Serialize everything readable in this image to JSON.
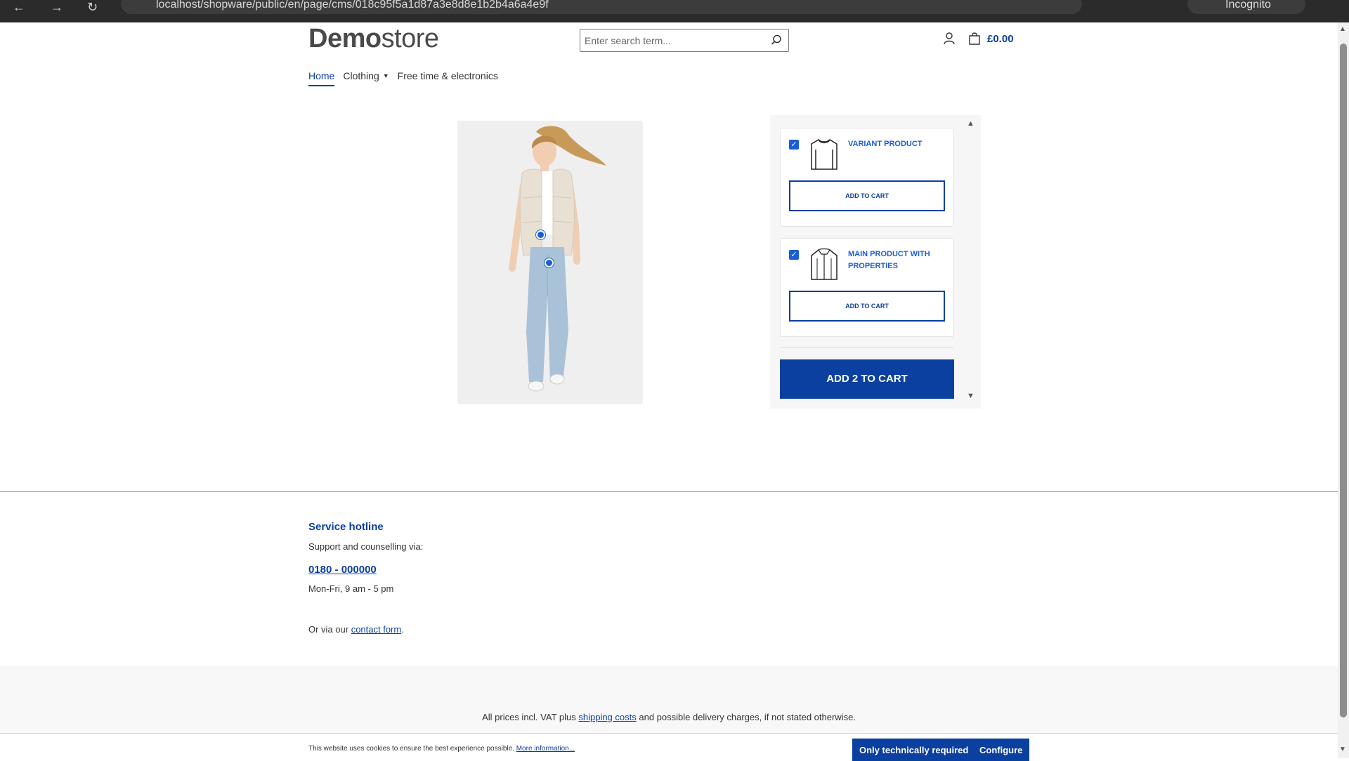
{
  "browser": {
    "url": "localhost/shopware/public/en/page/cms/018c95f5a1d87a3e8d8e1b2b4a6a4e9f",
    "mode_label": "Incognito"
  },
  "header": {
    "logo_bold": "Demo",
    "logo_light": "store",
    "search_placeholder": "Enter search term...",
    "cart_total": "£0.00"
  },
  "nav": {
    "items": [
      {
        "label": "Home",
        "active": true
      },
      {
        "label": "Clothing",
        "dropdown": true
      },
      {
        "label": "Free time & electronics"
      }
    ]
  },
  "cross_selling": {
    "products": [
      {
        "name": "VARIANT PRODUCT",
        "checked": true,
        "icon": "sweater-icon",
        "button": "ADD TO CART"
      },
      {
        "name": "MAIN PRODUCT WITH PROPERTIES",
        "checked": true,
        "icon": "jacket-icon",
        "button": "ADD TO CART"
      }
    ],
    "add_all_label": "ADD 2 TO CART"
  },
  "footer": {
    "hotline_title": "Service hotline",
    "hotline_desc": "Support and counselling via:",
    "phone": "0180 - 000000",
    "hours": "Mon-Fri, 9 am - 5 pm",
    "contact_prefix": "Or via our ",
    "contact_link": "contact form",
    "contact_suffix": ".",
    "vat_prefix": "All prices incl. VAT plus ",
    "vat_link": "shipping costs",
    "vat_suffix": " and possible delivery charges, if not stated otherwise."
  },
  "cookie": {
    "text": "This website uses cookies to ensure the best experience possible. ",
    "more_link": "More information...",
    "btn_required": "Only technically required",
    "btn_configure": "Configure"
  },
  "colors": {
    "accent": "#0b3fa0",
    "link": "#1a5dd6"
  }
}
